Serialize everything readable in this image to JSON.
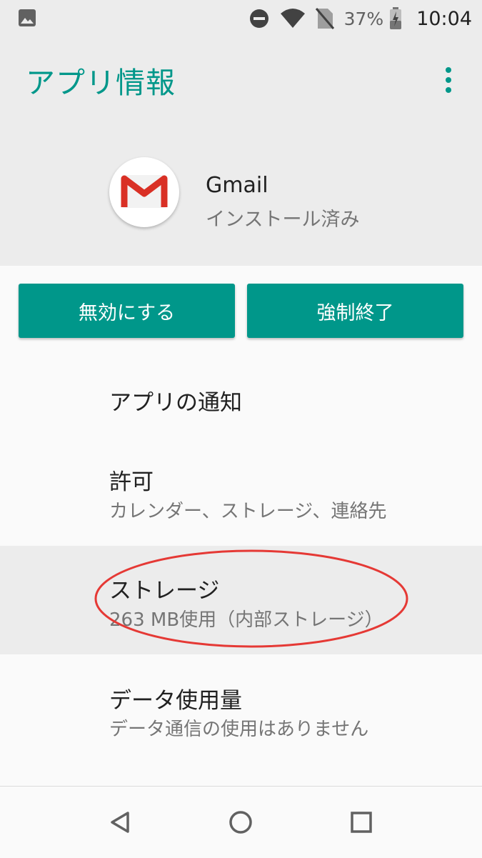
{
  "status_bar": {
    "icons": [
      "image-icon",
      "do-not-disturb-icon",
      "wifi-icon",
      "no-sim-icon",
      "battery-charging-icon"
    ],
    "battery_percent": "37%",
    "time": "10:04"
  },
  "header": {
    "title": "アプリ情報",
    "menu_icon": "more-vert-icon"
  },
  "app": {
    "icon": "gmail-icon",
    "name": "Gmail",
    "status": "インストール済み"
  },
  "buttons": {
    "disable_label": "無効にする",
    "force_stop_label": "強制終了"
  },
  "settings": {
    "notifications": {
      "title": "アプリの通知"
    },
    "permissions": {
      "title": "許可",
      "summary": "カレンダー、ストレージ、連絡先"
    },
    "storage": {
      "title": "ストレージ",
      "summary": "263 MB使用（内部ストレージ）"
    },
    "data_usage": {
      "title": "データ使用量",
      "summary": "データ通信の使用はありません"
    }
  },
  "annotation": {
    "color": "#e53935",
    "target": "storage"
  },
  "colors": {
    "accent": "#00978a",
    "header_bg": "#ececec"
  },
  "nav_bar": {
    "icons": [
      "back-icon",
      "home-icon",
      "recents-icon"
    ]
  }
}
